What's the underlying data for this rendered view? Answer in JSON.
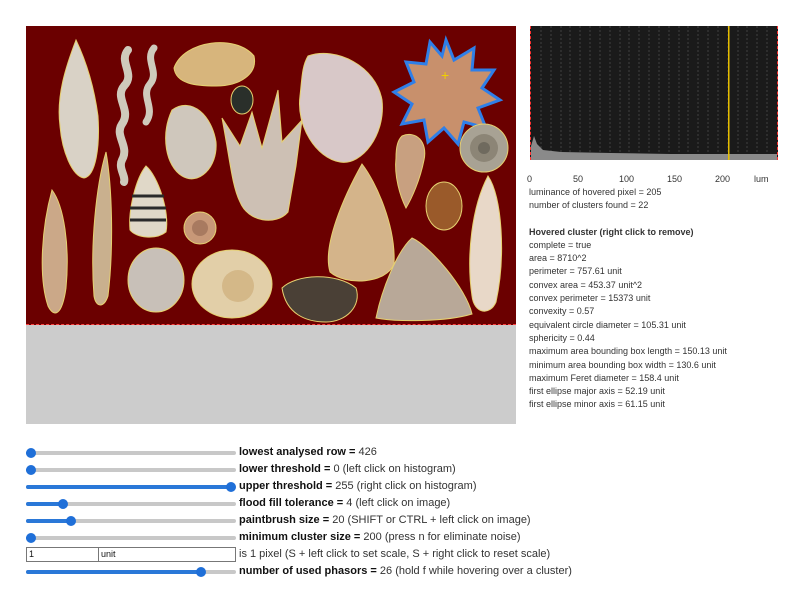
{
  "histogram": {
    "axis_ticks": [
      "0",
      "50",
      "100",
      "150",
      "200"
    ],
    "axis_unit": "lum",
    "marker_value": 205,
    "max_value": 255
  },
  "info": {
    "luminance": "luminance of hovered pixel = 205",
    "clusters_found": "number of clusters found = 22",
    "heading": "Hovered cluster (right click to remove)",
    "complete": "complete = true",
    "area": "area = 8710^2",
    "perimeter": "perimeter = 757.61 unit",
    "convex_area": "convex area = 453.37 unit^2",
    "convex_perimeter": "convex perimeter = 15373 unit",
    "convexity": "convexity = 0.57",
    "equiv_diameter": "equivalent circle diameter = 105.31 unit",
    "sphericity": "sphericity = 0.44",
    "max_bbox_length": "maximum area bounding box length = 150.13 unit",
    "min_bbox_width": "minimum area bounding box width = 130.6 unit",
    "max_feret": "maximum Feret diameter = 158.4 unit",
    "ellipse_major": "first ellipse major axis = 52.19 unit",
    "ellipse_minor": "first ellipse minor axis = 61.15 unit"
  },
  "controls": {
    "lowest_row": {
      "label": "lowest analysed row = ",
      "value": "426",
      "hint": "",
      "fraction": 0.0
    },
    "lower_threshold": {
      "label": "lower threshold = ",
      "value": "0",
      "hint": " (left click on histogram)",
      "fraction": 0.0
    },
    "upper_threshold": {
      "label": "upper threshold = ",
      "value": "255",
      "hint": " (right click on histogram)",
      "fraction": 1.0
    },
    "flood_fill": {
      "label": "flood fill tolerance = ",
      "value": "4",
      "hint": " (left click on image)",
      "fraction": 0.16
    },
    "paintbrush": {
      "label": "paintbrush size = ",
      "value": "20",
      "hint": " (SHIFT or CTRL + left click on image)",
      "fraction": 0.2
    },
    "min_cluster": {
      "label": "minimum cluster size = ",
      "value": "200",
      "hint": " (press n for eliminate noise)",
      "fraction": 0.0
    },
    "scale": {
      "pixel_value": "1",
      "unit_value": "unit",
      "hint": " is 1 pixel (S + left click to set scale, S + right click to reset scale)"
    },
    "phasors": {
      "label": "number of used phasors = ",
      "value": "26",
      "hint": " (hold f while hovering over a cluster)",
      "fraction": 0.85
    }
  },
  "colors": {
    "background_image": "#6b0000",
    "slider_accent": "#2a78d8",
    "histogram_bg": "#1a1a1a",
    "marker": "#e8c000",
    "hover_outline": "#2f7fe8"
  }
}
